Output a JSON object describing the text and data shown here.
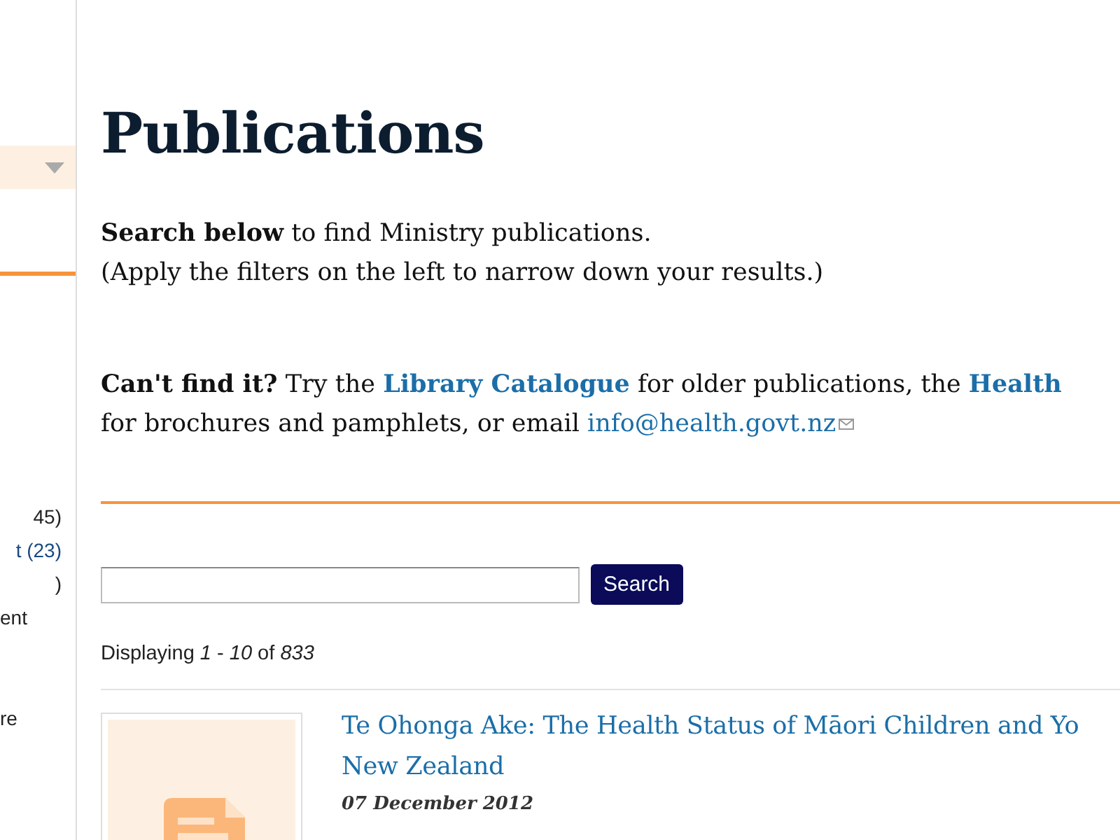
{
  "sidebar": {
    "dropdown": {
      "expanded": false
    },
    "filters": [
      "45)",
      "t (23)",
      ")",
      "ent",
      "re"
    ]
  },
  "heading": "Publications",
  "intro": {
    "bold": "Search below",
    "rest": "to find Ministry publications.",
    "note": "(Apply the filters on the left to narrow down your results.)"
  },
  "help": {
    "bold": "Can't find it?",
    "text_1": "Try the",
    "link_1": "Library Catalogue",
    "text_2": "for older publications, the",
    "link_2": "Health",
    "line_2": "for brochures and pamphlets, or email",
    "email": "info@health.govt.nz"
  },
  "search": {
    "button": "Search"
  },
  "results": {
    "label": "Displaying",
    "from": "1",
    "sep": "-",
    "to": "10",
    "of": "of",
    "total": "833"
  },
  "items": [
    {
      "title_lines": [
        "Te Ohonga Ake: The Health Status of Māori Children and Yo",
        "New Zealand"
      ],
      "date": "07 December 2012"
    }
  ]
}
